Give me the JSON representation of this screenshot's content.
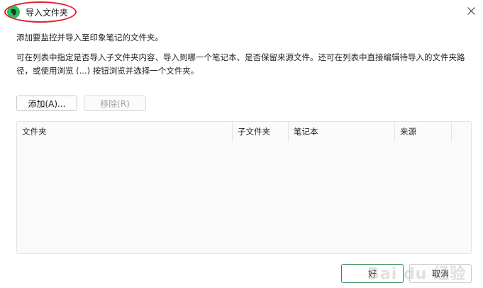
{
  "window": {
    "title": "导入文件夹",
    "app_icon": "evernote-elephant-icon",
    "close_icon": "close-icon"
  },
  "description": {
    "line1": "添加要监控并导入至印象笔记的文件夹。",
    "line2": "可在列表中指定是否导入子文件夹内容、导入到哪一个笔记本、是否保留来源文件。还可在列表中直接编辑待导入的文件夹路径，或使用浏览 (...) 按钮浏览并选择一个文件夹。"
  },
  "toolbar": {
    "add_label": "添加(A)...",
    "remove_label": "移除(R)"
  },
  "table": {
    "columns": [
      "文件夹",
      "子文件夹",
      "笔记本",
      "来源"
    ],
    "rows": []
  },
  "footer": {
    "ok_label": "好",
    "cancel_label": "取消"
  },
  "colors": {
    "accent_border": "#2e8a57",
    "annotation": "#e0242b",
    "app_icon": "#2dbe60"
  }
}
